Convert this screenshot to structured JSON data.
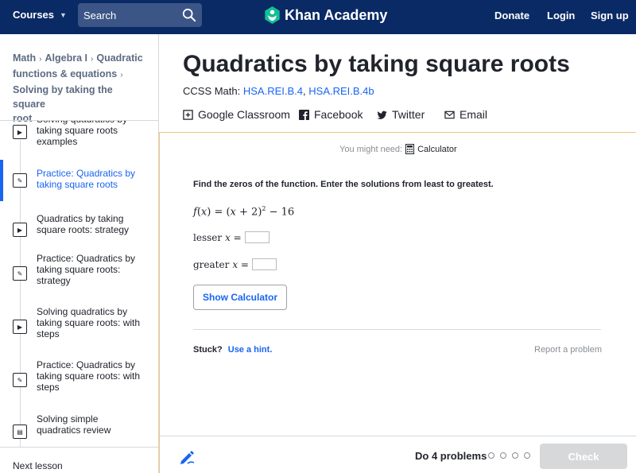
{
  "nav": {
    "courses": "Courses",
    "search_placeholder": "Search",
    "logo": "Khan Academy",
    "donate": "Donate",
    "login": "Login",
    "signup": "Sign up"
  },
  "breadcrumb": {
    "math": "Math",
    "algebra": "Algebra I",
    "quadratic_l1": "Quadratic",
    "quadratic_l2": "functions & equations",
    "lesson_l1": "Solving by taking the square",
    "lesson_l2": "root"
  },
  "sidebar": {
    "items": [
      {
        "label": "Solving quadratics by taking square roots examples",
        "icon": "play-icon"
      },
      {
        "label": "Practice: Quadratics by taking square roots",
        "icon": "pencil-icon"
      },
      {
        "label": "Quadratics by taking square roots: strategy",
        "icon": "play-icon"
      },
      {
        "label": "Practice: Quadratics by taking square roots: strategy",
        "icon": "pencil-icon"
      },
      {
        "label": "Solving quadratics by taking square roots: with steps",
        "icon": "play-icon"
      },
      {
        "label": "Practice: Quadratics by taking square roots: with steps",
        "icon": "pencil-icon"
      },
      {
        "label": "Solving simple quadratics review",
        "icon": "article-icon"
      }
    ],
    "next_lesson": "Next lesson"
  },
  "main": {
    "title": "Quadratics by taking square roots",
    "ccss_label": "CCSS Math:",
    "ccss_link1": "HSA.REI.B.4",
    "ccss_sep": ",",
    "ccss_link2": "HSA.REI.B.4b",
    "share": {
      "classroom": "Google Classroom",
      "facebook": "Facebook",
      "twitter": "Twitter",
      "email": "Email"
    }
  },
  "exercise": {
    "you_might_need": "You might need:",
    "calculator": "Calculator",
    "question": "Find the zeros of the function. Enter the solutions from least to greatest.",
    "lesser_label": "lesser",
    "greater_label": "greater",
    "x_eq": "x =",
    "show_calculator": "Show Calculator",
    "stuck": "Stuck?",
    "hint": "Use a hint.",
    "report": "Report a problem",
    "do_problems": "Do 4 problems",
    "check": "Check"
  },
  "colors": {
    "nav_bg": "#0a2a66",
    "link_blue": "#1865f2",
    "logo_green": "#14bf96",
    "frame_orange": "#f2c37a"
  }
}
